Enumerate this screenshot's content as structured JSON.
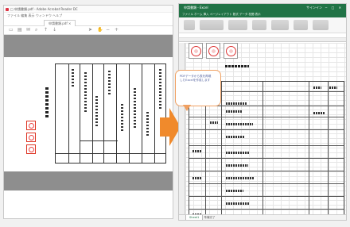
{
  "pdf_viewer": {
    "title": "□ 申請書類.pdf - Adobe Acrobat Reader DC",
    "menu": "ファイル  編集  表示  ウィンドウ  ヘルプ",
    "tab_label": "申請書類.pdf ×",
    "toolbar_icons": [
      "save-icon",
      "print-icon",
      "mail-icon",
      "search-icon",
      "prev-page-icon",
      "next-page-icon",
      "cursor-icon",
      "hand-icon",
      "zoom-out-icon",
      "zoom-in-icon"
    ]
  },
  "excel": {
    "title": "申請書類 - Excel",
    "user": "サインイン",
    "window_controls": "─ □ ✕",
    "ribbon_tabs": "ファイル  ホーム  挿入  ページレイアウト  数式  データ  校閲  表示",
    "callout_text": "PDFデータから表を再現\nしたExcelを作成します",
    "sheet_tab": "Sheet1",
    "status": "準備完了"
  },
  "colors": {
    "excel_green": "#217346",
    "arrow_orange": "#f08a2c",
    "seal_red": "#d33333",
    "callout_border": "#f0a061"
  }
}
